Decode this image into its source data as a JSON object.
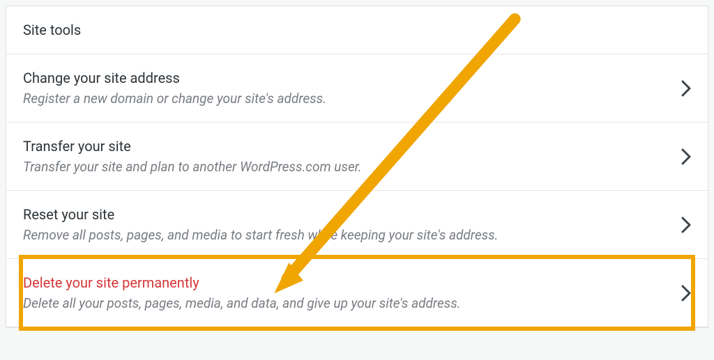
{
  "panel": {
    "header": "Site tools",
    "rows": [
      {
        "title": "Change your site address",
        "description": "Register a new domain or change your site's address."
      },
      {
        "title": "Transfer your site",
        "description": "Transfer your site and plan to another WordPress.com user."
      },
      {
        "title": "Reset your site",
        "description": "Remove all posts, pages, and media to start fresh while keeping your site's address."
      },
      {
        "title": "Delete your site permanently",
        "description": "Delete all your posts, pages, media, and data, and give up your site's address."
      }
    ]
  },
  "annotation": {
    "highlight_color": "#f0a500",
    "arrow_color": "#f0a500"
  }
}
